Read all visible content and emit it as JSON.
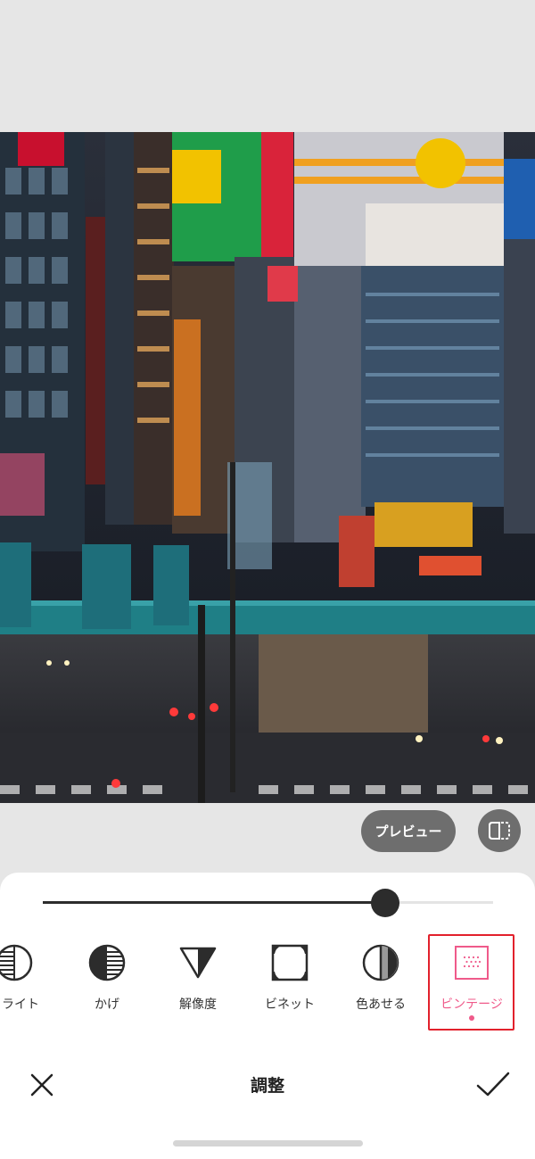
{
  "preview": {
    "label": "プレビュー"
  },
  "slider": {
    "value": 0.76
  },
  "tools": [
    {
      "label": "イライト",
      "icon": "highlight-icon"
    },
    {
      "label": "かげ",
      "icon": "shadow-icon"
    },
    {
      "label": "解像度",
      "icon": "sharpness-icon"
    },
    {
      "label": "ビネット",
      "icon": "vignette-icon"
    },
    {
      "label": "色あせる",
      "icon": "fade-icon"
    },
    {
      "label": "ビンテージ",
      "icon": "vintage-icon"
    }
  ],
  "active_tool": "ビンテージ",
  "title": "調整",
  "colors": {
    "accent": "#ef5a8a",
    "selection": "#e2212c",
    "dark": "#2c2c2c"
  }
}
